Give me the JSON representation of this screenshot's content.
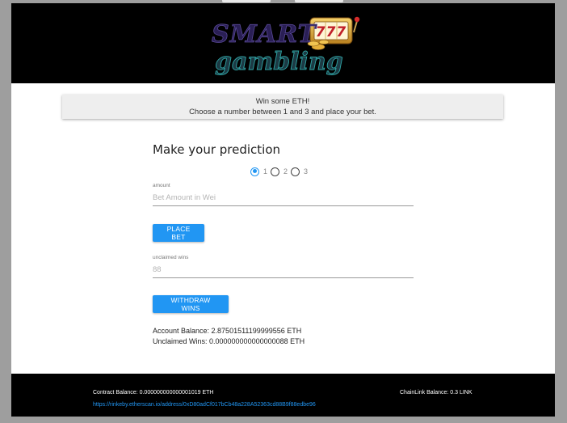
{
  "header": {
    "logo_text_line1": "SMART",
    "logo_text_line2": "gambling",
    "logo_reels": "777"
  },
  "banner": {
    "line1": "Win some ETH!",
    "line2": "Choose a number between 1 and 3 and place your bet."
  },
  "prediction": {
    "title": "Make your prediction",
    "options": [
      {
        "label": "1",
        "checked": true
      },
      {
        "label": "2",
        "checked": false
      },
      {
        "label": "3",
        "checked": false
      }
    ]
  },
  "amount_field": {
    "label": "amount",
    "placeholder": "Bet Amount in Wei",
    "value": ""
  },
  "place_bet_button": "PLACE BET",
  "unclaimed_field": {
    "label": "unclaimed wins",
    "placeholder": "88",
    "value": ""
  },
  "withdraw_button": "WITHDRAW WINS",
  "account": {
    "balance_text": "Account Balance: 2.87501511199999556 ETH",
    "unclaimed_text": "Unclaimed Wins: 0.000000000000000088 ETH"
  },
  "footer": {
    "contract_balance": "Contract Balance: 0.000000000000001019 ETH",
    "chainlink_balance": "ChainLink Balance: 0.3 LINK",
    "etherscan_link": "https://rinkeby.etherscan.io/address/0xD80adCf017bCb48a228A52363cd88B9f88edbe96"
  },
  "colors": {
    "primary": "#2196f3",
    "header_bg": "#000000",
    "banner_bg": "#eeeeee",
    "logo_purple": "#3a2a6e",
    "logo_teal": "#2fa6a6",
    "logo_gold": "#e6b03a"
  }
}
